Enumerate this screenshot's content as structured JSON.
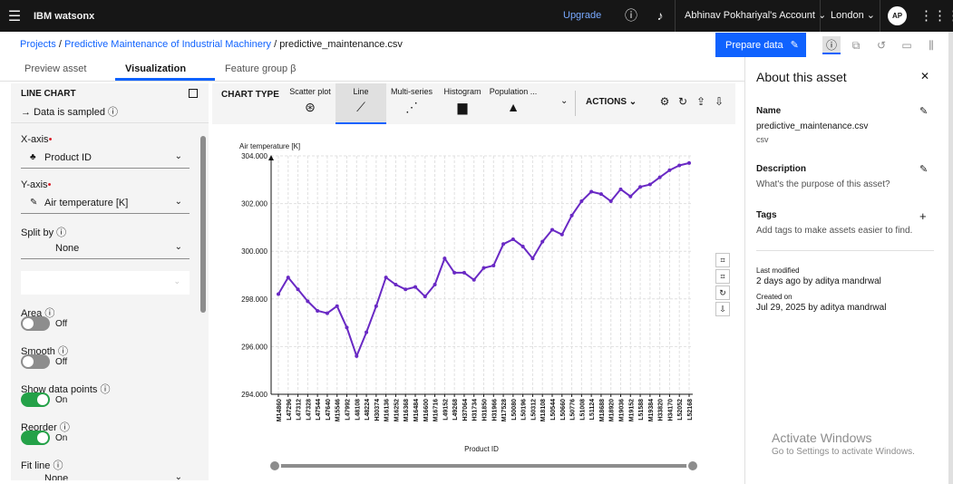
{
  "topbar": {
    "brand": "IBM watsonx",
    "upgrade": "Upgrade",
    "account": "Abhinav Pokhariyal's Account",
    "region": "London",
    "avatar": "AP"
  },
  "breadcrumb": {
    "items": [
      "Projects",
      "Predictive Maintenance of Industrial Machinery",
      "predictive_maintenance.csv"
    ],
    "sep": "/"
  },
  "prepare_data": "Prepare data",
  "tabs": [
    "Preview asset",
    "Visualization",
    "Feature group β"
  ],
  "left": {
    "title": "LINE CHART",
    "sampled": "Data is sampled",
    "xaxis_label": "X-axis",
    "xaxis_value": "Product ID",
    "yaxis_label": "Y-axis",
    "yaxis_value": "Air temperature [K]",
    "split_label": "Split by",
    "split_value": "None",
    "toggles": [
      {
        "label": "Area",
        "state": "Off"
      },
      {
        "label": "Smooth",
        "state": "Off"
      },
      {
        "label": "Show data points",
        "state": "On"
      },
      {
        "label": "Reorder",
        "state": "On"
      }
    ],
    "fit_label": "Fit line",
    "fit_value": "None"
  },
  "chart_types": {
    "title": "CHART TYPE",
    "items": [
      "Scatter plot",
      "Line",
      "Multi-series",
      "Histogram",
      "Population ..."
    ],
    "actions": "ACTIONS"
  },
  "chart_data": {
    "type": "line",
    "ylabel": "Air temperature [K]",
    "xlabel": "Product ID",
    "ylim": [
      294,
      304
    ],
    "yticks": [
      "294.000",
      "296.000",
      "298.000",
      "300.000",
      "302.000",
      "304.000"
    ],
    "x": [
      "M14860",
      "L47296",
      "L47312",
      "L47328",
      "L47544",
      "L47640",
      "M15546",
      "L47992",
      "L48108",
      "L48224",
      "H30374",
      "M16136",
      "M16252",
      "M16368",
      "M16484",
      "M16600",
      "M16716",
      "L49152",
      "L49268",
      "H37064",
      "H31734",
      "H31850",
      "H31966",
      "M17528",
      "L50080",
      "L50196",
      "L50312",
      "M18108",
      "L50544",
      "L50660",
      "L50776",
      "L51008",
      "L51124",
      "M18688",
      "M18920",
      "M19036",
      "M19152",
      "L51588",
      "M19384",
      "H33820",
      "H34170",
      "L52052",
      "L52168"
    ],
    "values": [
      298.2,
      298.9,
      298.4,
      297.9,
      297.5,
      297.4,
      297.7,
      296.8,
      295.6,
      296.6,
      297.7,
      298.9,
      298.6,
      298.4,
      298.5,
      298.1,
      298.6,
      299.7,
      299.1,
      299.1,
      298.8,
      299.3,
      299.4,
      300.3,
      300.5,
      300.2,
      299.7,
      300.4,
      300.9,
      300.7,
      301.5,
      302.1,
      302.5,
      302.4,
      302.1,
      302.6,
      302.3,
      302.7,
      302.8,
      303.1,
      303.4,
      303.6,
      303.7
    ]
  },
  "about": {
    "title": "About this asset",
    "name_h": "Name",
    "name": "predictive_maintenance.csv",
    "type": "csv",
    "desc_h": "Description",
    "desc": "What's the purpose of this asset?",
    "tags_h": "Tags",
    "tags": "Add tags to make assets easier to find.",
    "modified_h": "Last modified",
    "modified": "2 days ago by aditya mandrwal",
    "created_h": "Created on",
    "created": "Jul 29, 2025 by aditya mandrwal"
  },
  "watermark": {
    "line1": "Activate Windows",
    "line2": "Go to Settings to activate Windows."
  }
}
